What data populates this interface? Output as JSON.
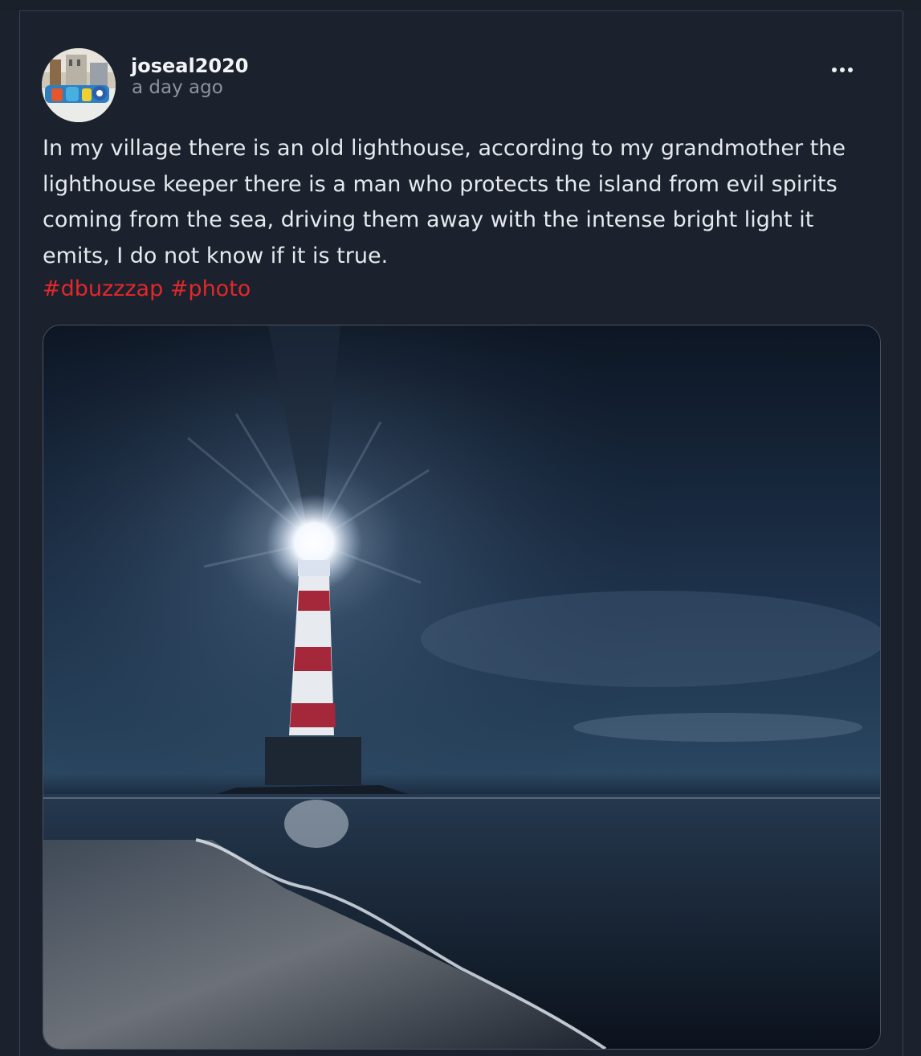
{
  "post": {
    "author": "joseal2020",
    "timestamp": "a day ago",
    "body": "In my village there is an old lighthouse, according to my grandmother the lighthouse keeper there is a man who protects the island from evil spirits coming from the sea, driving them away with the intense bright light it emits, I do not know if it is true.",
    "hashtags": [
      "#dbuzzzap",
      "#photo"
    ],
    "more_icon": "more-horizontal-icon"
  },
  "colors": {
    "background": "#1b222d",
    "hashtag": "#e3272b",
    "text": "#e6e9ee",
    "muted": "#8b939e"
  }
}
